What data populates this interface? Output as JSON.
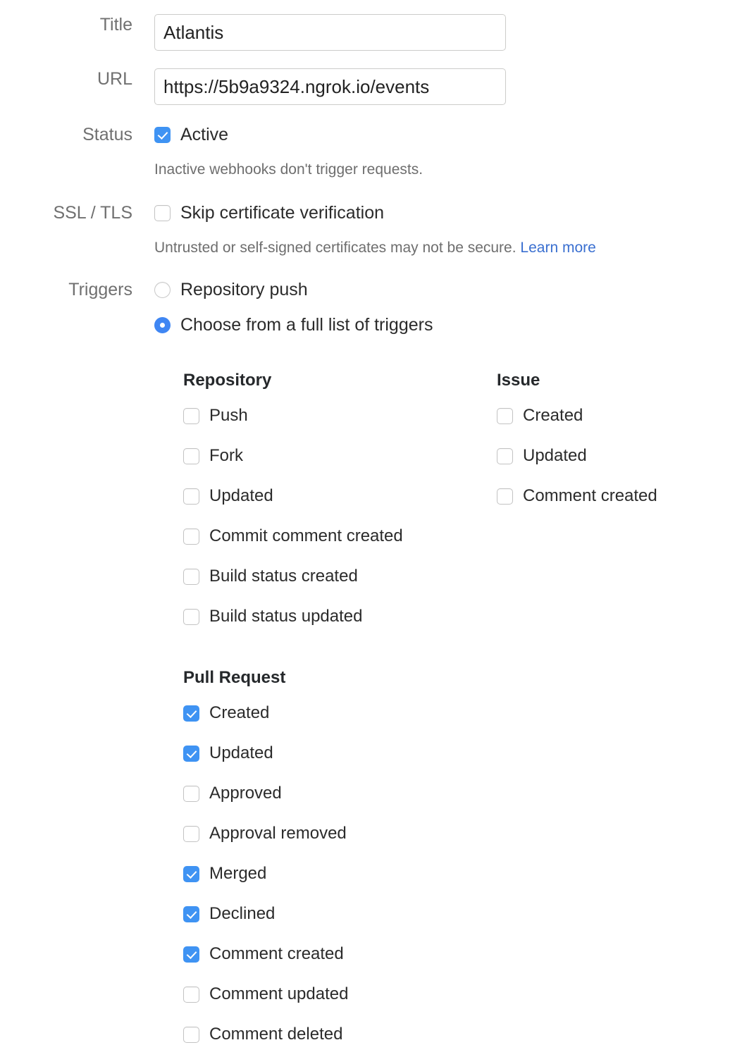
{
  "form": {
    "title_label": "Title",
    "title_value": "Atlantis",
    "title_placeholder": "Title",
    "url_label": "URL",
    "url_value": "https://5b9a9324.ngrok.io/events",
    "url_placeholder": "URL",
    "status_label": "Status",
    "status_option_label": "Active",
    "status_checked": true,
    "status_helper": "Inactive webhooks don't trigger requests.",
    "ssl_label": "SSL / TLS",
    "ssl_option_label": "Skip certificate verification",
    "ssl_checked": false,
    "ssl_helper_text": "Untrusted or self-signed certificates may not be secure.",
    "ssl_helper_link": "Learn more",
    "triggers_label": "Triggers",
    "trigger_mode_options": [
      {
        "label": "Repository push",
        "selected": false
      },
      {
        "label": "Choose from a full list of triggers",
        "selected": true
      }
    ]
  },
  "trigger_groups": {
    "repository": {
      "title": "Repository",
      "items": [
        {
          "label": "Push",
          "checked": false
        },
        {
          "label": "Fork",
          "checked": false
        },
        {
          "label": "Updated",
          "checked": false
        },
        {
          "label": "Commit comment created",
          "checked": false
        },
        {
          "label": "Build status created",
          "checked": false
        },
        {
          "label": "Build status updated",
          "checked": false
        }
      ]
    },
    "issue": {
      "title": "Issue",
      "items": [
        {
          "label": "Created",
          "checked": false
        },
        {
          "label": "Updated",
          "checked": false
        },
        {
          "label": "Comment created",
          "checked": false
        }
      ]
    },
    "pull_request": {
      "title": "Pull Request",
      "items": [
        {
          "label": "Created",
          "checked": true
        },
        {
          "label": "Updated",
          "checked": true
        },
        {
          "label": "Approved",
          "checked": false
        },
        {
          "label": "Approval removed",
          "checked": false
        },
        {
          "label": "Merged",
          "checked": true
        },
        {
          "label": "Declined",
          "checked": true
        },
        {
          "label": "Comment created",
          "checked": true
        },
        {
          "label": "Comment updated",
          "checked": false
        },
        {
          "label": "Comment deleted",
          "checked": false
        }
      ]
    }
  },
  "colors": {
    "accent": "#3f93f3",
    "radio_accent": "#3f86f3",
    "label_gray": "#707070",
    "helper_gray": "#6e6e6e",
    "link_blue": "#3a6fd0",
    "input_border": "#ccccca",
    "text": "#2b2b2b"
  }
}
